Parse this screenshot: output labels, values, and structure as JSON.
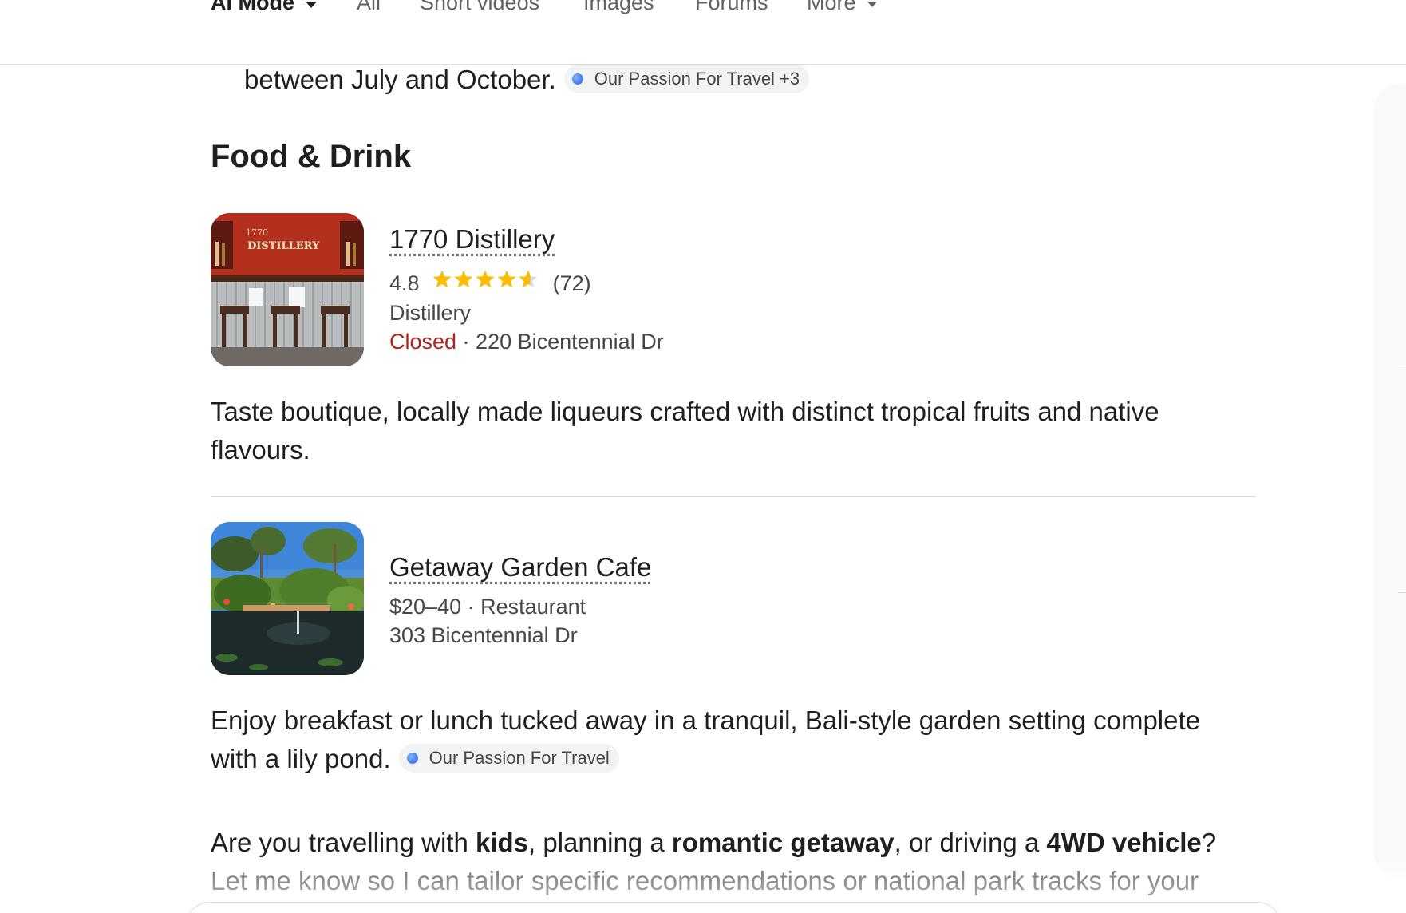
{
  "tabs": [
    {
      "label": "AI Mode",
      "active": true,
      "has_dropdown": true
    },
    {
      "label": "All"
    },
    {
      "label": "Short videos"
    },
    {
      "label": "Images"
    },
    {
      "label": "Forums"
    },
    {
      "label": "More",
      "has_dropdown": true
    }
  ],
  "previous_text": {
    "text": "between July and October.",
    "source_chip": "Our Passion For Travel +3"
  },
  "section": {
    "title": "Food & Drink"
  },
  "places": [
    {
      "name": "1770 Distillery",
      "rating": "4.8",
      "rating_value": 4.8,
      "stars_total": 5,
      "review_count": "(72)",
      "category": "Distillery",
      "status": "Closed",
      "separator": " · ",
      "address": "220 Bicentennial Dr",
      "description": "Taste boutique, locally made liqueurs crafted with distinct tropical fruits and native flavours.",
      "image_icon": "distillery-bar-photo"
    },
    {
      "name": "Getaway Garden Cafe",
      "price": "$20–40",
      "separator": " · ",
      "category": "Restaurant",
      "address": "303 Bicentennial Dr",
      "description": "Enjoy breakfast or lunch tucked away in a tranquil, Bali-style garden setting complete with a lily pond.",
      "source_chip": "Our Passion For Travel",
      "image_icon": "garden-pond-photo"
    }
  ],
  "closing": {
    "p1": "Are you travelling with ",
    "b1": "kids",
    "p2": ", planning a ",
    "b2": "romantic getaway",
    "p3": ", or driving a ",
    "b3": "4WD vehicle",
    "p4": "? Let me know so I can tailor specific recommendations or national park tracks for your"
  },
  "colors": {
    "closed": "#b3261e",
    "star": "#fbbc04",
    "chip_bg": "#f1f3f4",
    "divider": "#dadce0"
  }
}
